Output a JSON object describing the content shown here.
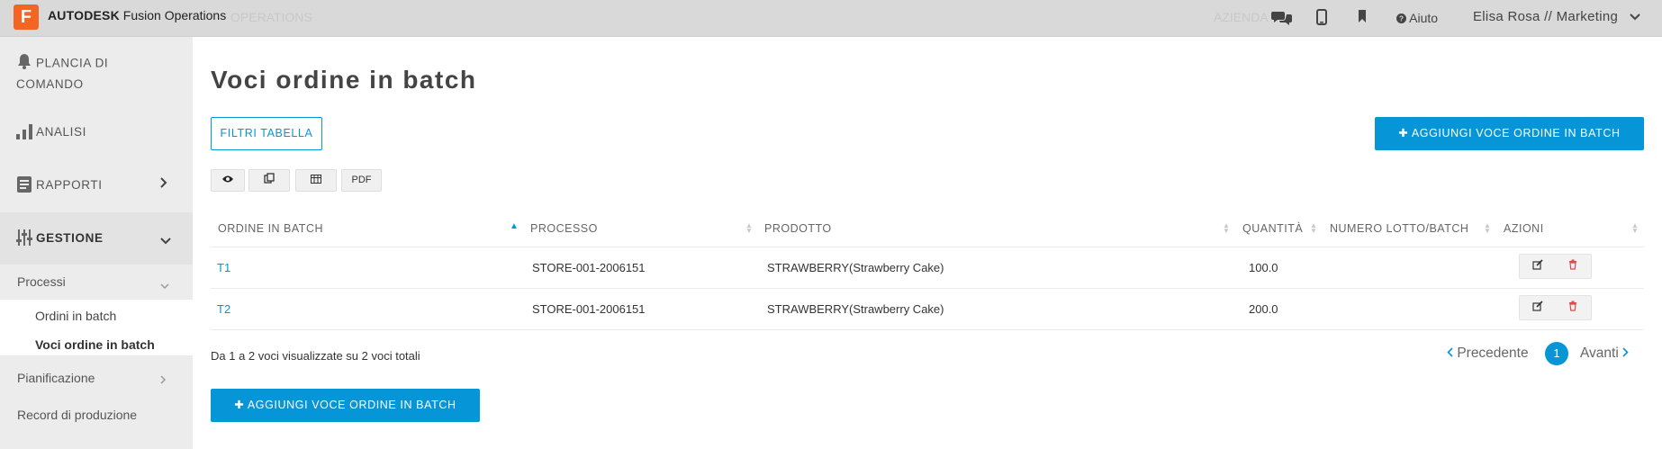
{
  "app": {
    "brand_bold": "AUTODESK",
    "brand_rest": "Fusion Operations",
    "logo_letter": "F",
    "help_label": "Aiuto",
    "user_label": "Elisa Rosa // Marketing",
    "faded_left": "OPERATIONS",
    "faded_right": "AZIENDA"
  },
  "sidebar": {
    "plancia_line1": "PLANCIA DI",
    "plancia_line2": "COMANDO",
    "analisi": "ANALISI",
    "rapporti": "RAPPORTI",
    "gestione": "GESTIONE",
    "processi": "Processi",
    "ordini_in_batch": "Ordini in batch",
    "voci_ordine_in_batch": "Voci ordine in batch",
    "pianificazione": "Pianificazione",
    "record_di_produzione": "Record di produzione"
  },
  "main": {
    "title": "Voci ordine in batch",
    "filters_button": "FILTRI TABELLA",
    "add_button": "AGGIUNGI VOCE ORDINE IN BATCH",
    "pdf_button": "PDF"
  },
  "table": {
    "columns": [
      "ORDINE IN BATCH",
      "PROCESSO",
      "PRODOTTO",
      "QUANTITÀ",
      "NUMERO LOTTO/BATCH",
      "AZIONI"
    ],
    "rows": [
      {
        "ordine": "T1",
        "processo": "STORE-001-2006151",
        "prodotto": "STRAWBERRY(Strawberry Cake)",
        "quantita": "100.0",
        "lotto": ""
      },
      {
        "ordine": "T2",
        "processo": "STORE-001-2006151",
        "prodotto": "STRAWBERRY(Strawberry Cake)",
        "quantita": "200.0",
        "lotto": ""
      }
    ]
  },
  "footer": {
    "info": "Da 1 a 2 voci visualizzate su 2 voci totali",
    "prev": "Precedente",
    "page": "1",
    "next": "Avanti"
  },
  "colors": {
    "accent": "#0696d7",
    "logo": "#f26522",
    "delete": "#e04a4a"
  }
}
